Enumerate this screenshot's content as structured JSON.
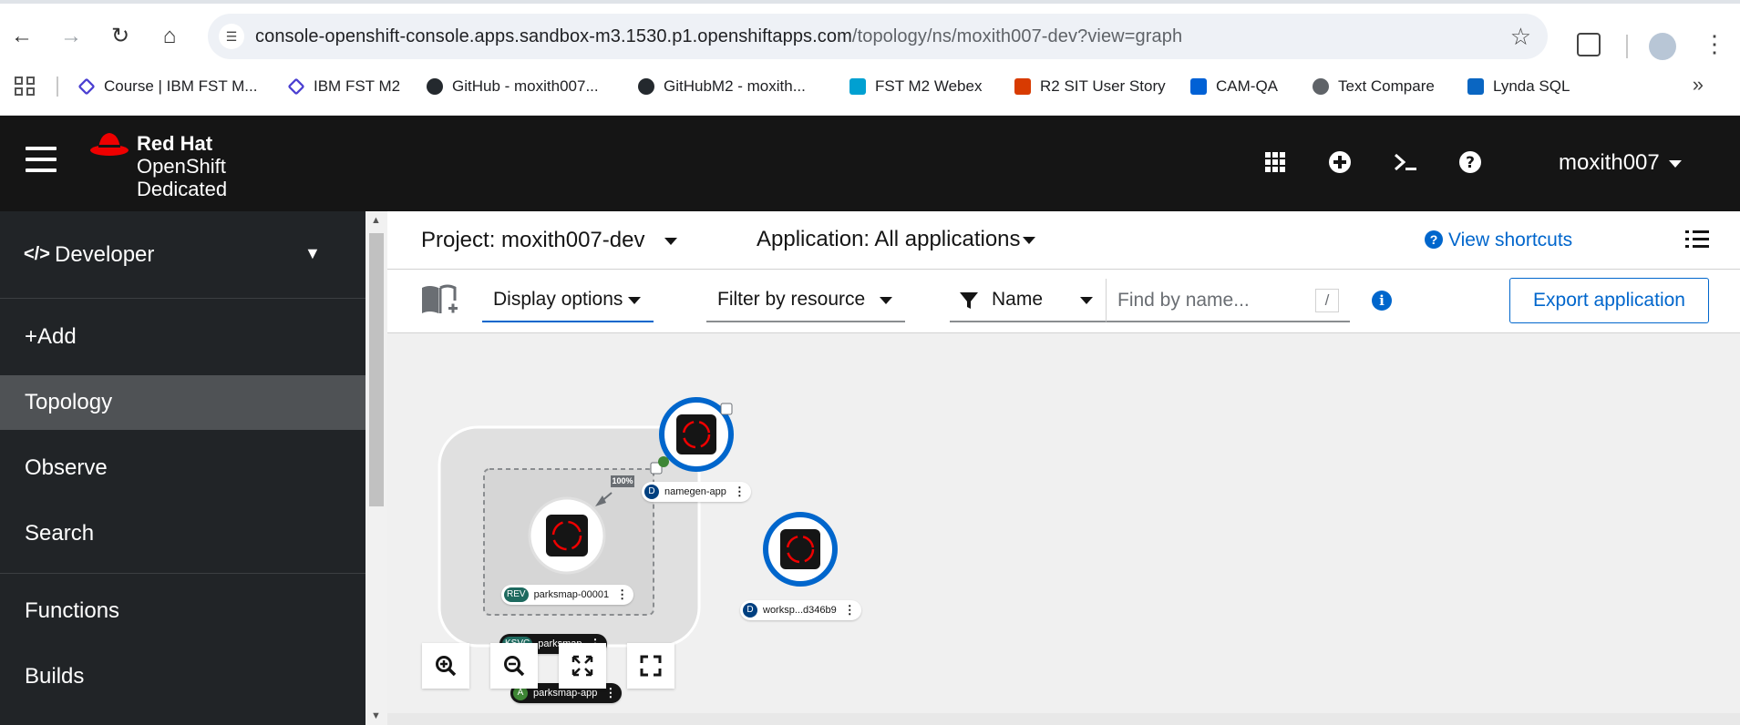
{
  "browser": {
    "url_host": "console-openshift-console.apps.sandbox-m3.1530.p1.openshiftapps.com",
    "url_path": "/topology/ns/moxith007-dev?view=graph",
    "bookmarks": [
      {
        "label": "Course | IBM FST M...",
        "icon": "diamond-icon",
        "color": "#4b3fd1"
      },
      {
        "label": "IBM FST M2",
        "icon": "diamond-icon",
        "color": "#4b3fd1"
      },
      {
        "label": "GitHub - moxith007...",
        "icon": "github-icon",
        "color": "#24292e"
      },
      {
        "label": "GitHubM2 - moxith...",
        "icon": "github-icon",
        "color": "#24292e"
      },
      {
        "label": "FST M2 Webex",
        "icon": "webex-icon",
        "color": "#00a0d1"
      },
      {
        "label": "R2 SIT User Story",
        "icon": "office-icon",
        "color": "#d83b01"
      },
      {
        "label": "CAM-QA",
        "icon": "box-icon",
        "color": "#0061d5"
      },
      {
        "label": "Text Compare",
        "icon": "globe-icon",
        "color": "#5f6368"
      },
      {
        "label": "Lynda SQL",
        "icon": "lynda-icon",
        "color": "#0a66c2"
      }
    ]
  },
  "masthead": {
    "brand_1": "Red Hat",
    "brand_2": "OpenShift",
    "brand_3": "Dedicated",
    "user": "moxith007"
  },
  "sidebar": {
    "perspective": "Developer",
    "items": [
      {
        "label": "+Add",
        "active": false
      },
      {
        "label": "Topology",
        "active": true
      },
      {
        "label": "Observe",
        "active": false
      },
      {
        "label": "Search",
        "active": false
      },
      {
        "label": "Functions",
        "active": false
      },
      {
        "label": "Builds",
        "active": false
      }
    ]
  },
  "context": {
    "project": "Project: moxith007-dev",
    "application": "Application: All applications",
    "shortcuts": "View shortcuts"
  },
  "toolbar": {
    "display_options": "Display options",
    "filter_by_resource": "Filter by resource",
    "filter_type": "Name",
    "search_placeholder": "Find by name...",
    "search_shortcut": "/",
    "export": "Export application"
  },
  "topology": {
    "namegen_badge": "D",
    "namegen_label": "namegen-app",
    "traffic": "100%",
    "revision_badge": "REV",
    "revision_label": "parksmap-00001",
    "ksvc_badge": "KSVC",
    "ksvc_label": "parksmap",
    "app_badge": "A",
    "app_label": "parksmap-app",
    "worksp_badge": "D",
    "worksp_label": "worksp...d346b9",
    "colors": {
      "deployment_badge": "#004080",
      "revision_badge": "#1e6a5f",
      "ksvc_badge": "#1e6a5f",
      "app_badge": "#3e8635",
      "ring": "#0066cc"
    }
  }
}
